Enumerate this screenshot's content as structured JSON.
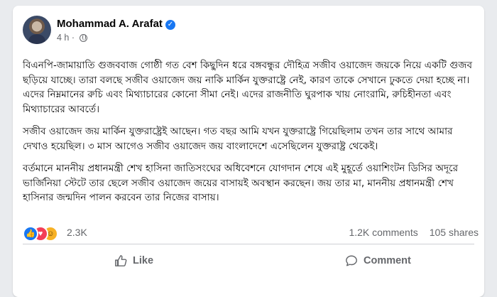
{
  "post": {
    "author": "Mohammad A. Arafat",
    "timestamp": "4 h",
    "visibility_icon": "globe-icon",
    "paragraphs": [
      "বিএনপি-জামায়াতি গুজববাজ গোষ্ঠী গত বেশ কিছুদিন ধরে বঙ্গবন্ধুর দৌহিত্র সজীব ওয়াজেদ জয়কে নিয়ে একটি গুজব ছড়িয়ে যাচ্ছে। তারা বলছে সজীব ওয়াজেদ জয় নাকি মার্কিন যুক্তরাষ্ট্রে নেই, কারণ তাকে সেখানে ঢুকতে দেয়া হচ্ছে না। এদের নিম্নমানের রুচি এবং মিথ্যাচারের কোনো সীমা নেই। এদের রাজনীতি ঘুরপাক খায় নোংরামি, রুচিহীনতা এবং মিথ্যাচারের আবর্তে।",
      "সজীব ওয়াজেদ জয় মার্কিন যুক্তরাষ্ট্রেই আছেন। গত বছর আমি যখন যুক্তরাষ্ট্রে গিয়েছিলাম তখন তার সাথে আমার দেখাও হয়েছিল। ৩ মাস আগেও সজীব ওয়াজেদ জয় বাংলাদেশে এসেছিলেন যুক্তরাষ্ট্র থেকেই।",
      "বর্তমানে মাননীয় প্রধানমন্ত্রী শেখ হাসিনা জাতিসংঘের অধিবেশনে যোগদান শেষে এই মুহূর্তে ওয়াশিংটন ডিসির অদূরে ভার্জিনিয়া স্টেটে তার ছেলে সজীব ওয়াজেদ জয়ের বাসায়ই অবস্থান করছেন। জয় তার মা, মাননীয় প্রধানমন্ত্রী শেখ হাসিনার জন্মদিন পালন করবেন তার নিজের বাসায়।"
    ],
    "reactions": {
      "icons": [
        "like-reaction-icon",
        "love-reaction-icon",
        "haha-reaction-icon"
      ],
      "count": "2.3K"
    },
    "comments_count": "1.2K comments",
    "shares_count": "105 shares",
    "actions": {
      "like_label": "Like",
      "comment_label": "Comment"
    },
    "colors": {
      "brand_blue": "#1877f2",
      "love_red": "#f33e58",
      "haha_yellow": "#f7b125",
      "secondary_text": "#65676b"
    }
  }
}
